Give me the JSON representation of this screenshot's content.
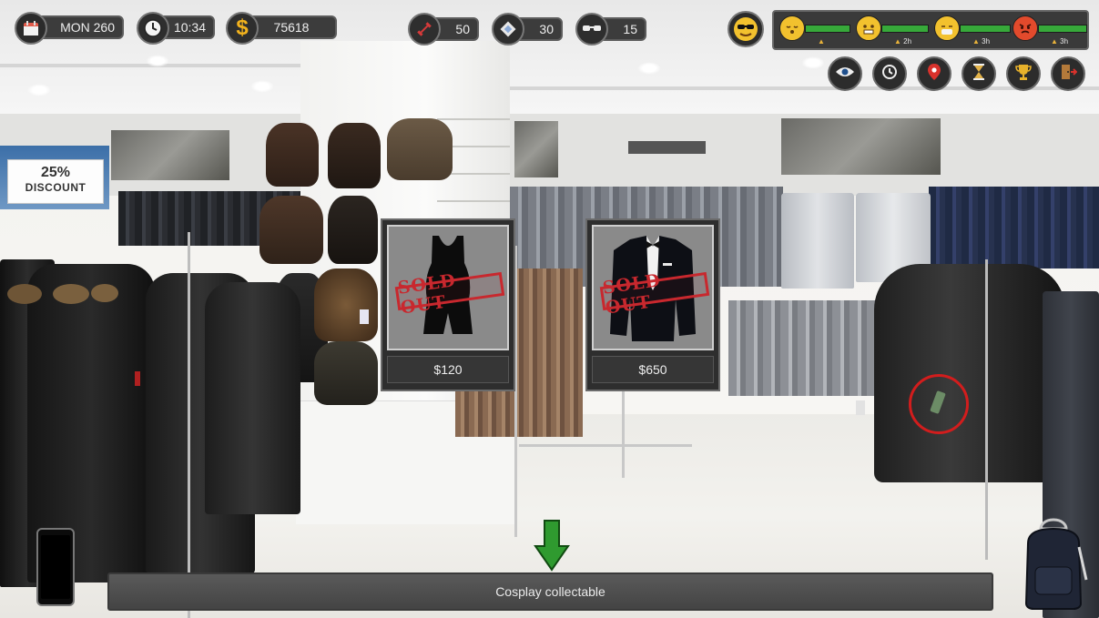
{
  "hud": {
    "day_label": "MON 260",
    "time": "10:34",
    "money": "75618",
    "stat_strength": "50",
    "stat_item": "30",
    "stat_stealth": "15"
  },
  "mood": {
    "face_icon": "cool-face-icon",
    "meters": [
      {
        "icon": "sleepy-face-icon",
        "level": 0.85,
        "note": ""
      },
      {
        "icon": "cold-face-icon",
        "level": 0.8,
        "note": "2h"
      },
      {
        "icon": "sick-face-icon",
        "level": 0.9,
        "note": "3h"
      },
      {
        "icon": "angry-face-icon",
        "level": 0.95,
        "note": "3h"
      }
    ]
  },
  "actions": [
    {
      "name": "look-button",
      "icon": "eye-icon"
    },
    {
      "name": "history-button",
      "icon": "history-icon"
    },
    {
      "name": "map-button",
      "icon": "location-pin-icon"
    },
    {
      "name": "wait-button",
      "icon": "hourglass-icon"
    },
    {
      "name": "trophy-button",
      "icon": "trophy-icon"
    },
    {
      "name": "exit-button",
      "icon": "exit-door-icon"
    }
  ],
  "store": {
    "discount_value": "25%",
    "discount_label": "DISCOUNT"
  },
  "products": [
    {
      "name": "black swimsuit",
      "price": "$120",
      "status": "SOLD OUT"
    },
    {
      "name": "black tuxedo",
      "price": "$650",
      "status": "SOLD OUT"
    }
  ],
  "message": "Cosplay collectable",
  "colors": {
    "accent_green": "#2f9a2f",
    "sold_out_red": "#c8282e",
    "hud_dark": "#3c3c3c"
  }
}
